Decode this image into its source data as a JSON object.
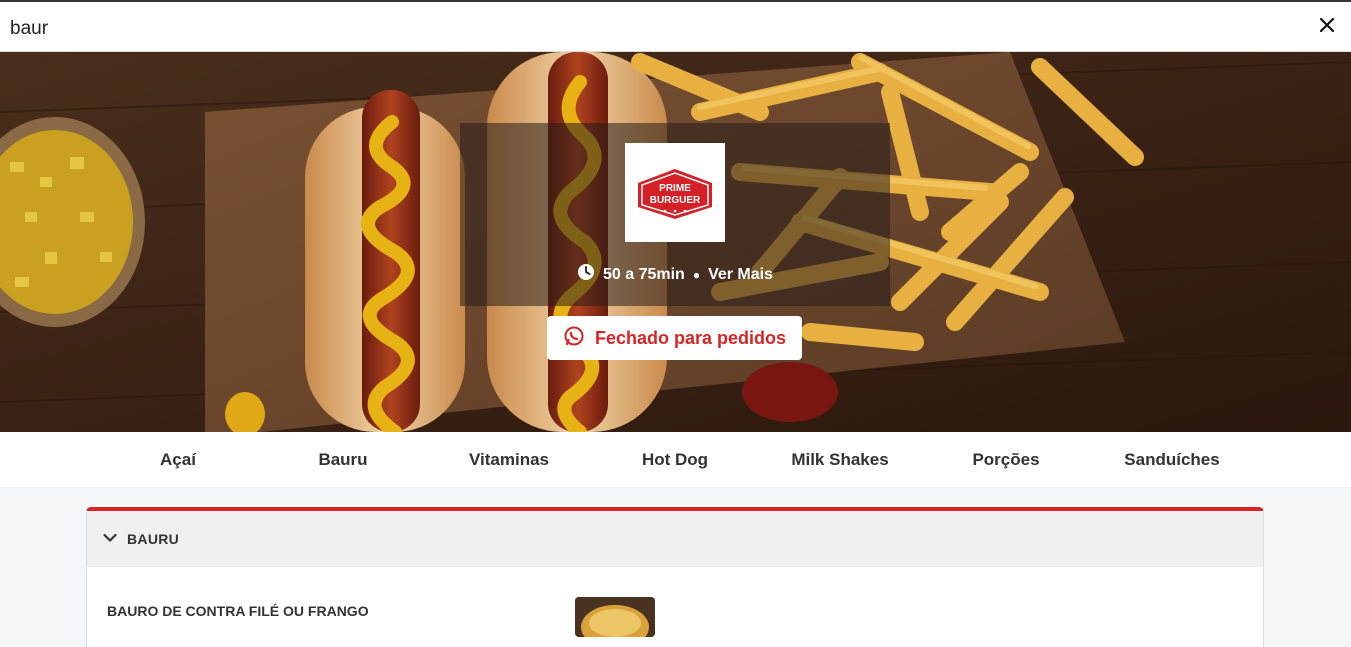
{
  "search": {
    "value": "baur",
    "placeholder": ""
  },
  "restaurant": {
    "logo_text_1": "PRIME",
    "logo_text_2": "BURGUER",
    "delivery_time": "50 a 75min",
    "separator": "●",
    "more_label": "Ver Mais",
    "status_label": "Fechado para pedidos"
  },
  "categories": [
    "Açaí",
    "Bauru",
    "Vitaminas",
    "Hot Dog",
    "Milk Shakes",
    "Porções",
    "Sanduíches"
  ],
  "section": {
    "title": "BAURU"
  },
  "products": [
    {
      "name": "BAURO DE CONTRA FILÉ OU FRANGO"
    }
  ],
  "colors": {
    "accent": "#d42626",
    "logo_red": "#d42026"
  }
}
